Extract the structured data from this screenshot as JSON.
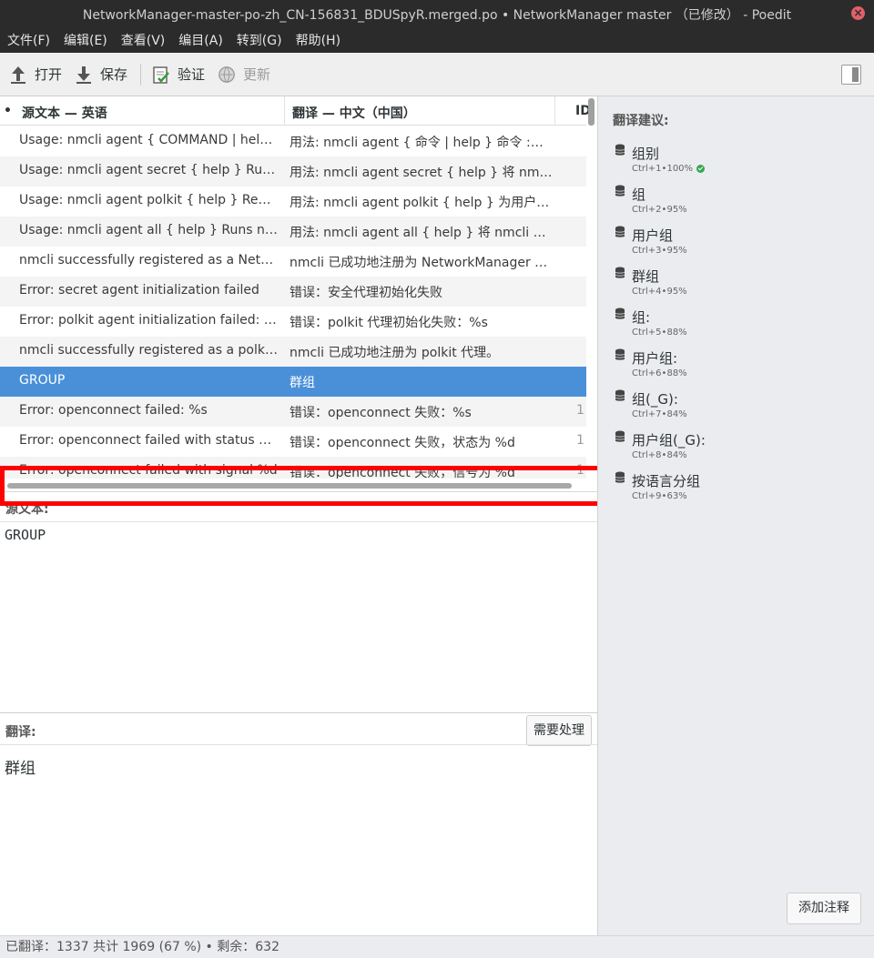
{
  "window": {
    "title": "NetworkManager-master-po-zh_CN-156831_BDUSpyR.merged.po • NetworkManager master （已修改） - Poedit",
    "close_glyph": "×"
  },
  "menu": [
    "文件(F)",
    "编辑(E)",
    "查看(V)",
    "编目(A)",
    "转到(G)",
    "帮助(H)"
  ],
  "toolbar": {
    "open_label": "打开",
    "save_label": "保存",
    "validate_label": "验证",
    "update_label": "更新"
  },
  "list": {
    "header_dot": "•",
    "col_source": "源文本 — 英语",
    "col_translation": "翻译 — 中文（中国）",
    "col_id": "ID",
    "rows": [
      {
        "src": "Usage: nmcli agent { COMMAND | help }  COMMAND := { secret | polkit | all }",
        "tr": "用法: nmcli agent { 命令 | help }  命令 := { secret | polkit | all }",
        "id": ""
      },
      {
        "src": "Usage: nmcli agent secret { help }  Runs nmcli as a NetworkManager secret agent.",
        "tr": "用法: nmcli agent secret { help }  将 nmcli 作为 NetworkManager 机密代理运行。",
        "id": ""
      },
      {
        "src": "Usage: nmcli agent polkit { help }  Registers nmcli as a polkit agent.",
        "tr": "用法: nmcli agent polkit { help }  为用户会话注册 nmcli 作为 polkit 代理。",
        "id": ""
      },
      {
        "src": "Usage: nmcli agent all { help }  Runs nmcli as both secret and polkit agent.",
        "tr": "用法: nmcli agent all { help }  将 nmcli 作为机密和 polkit 代理运行。",
        "id": ""
      },
      {
        "src": "nmcli successfully registered as a NetworkManager's secret agent.",
        "tr": "nmcli 已成功地注册为 NetworkManager 的机密代理。",
        "id": ""
      },
      {
        "src": "Error: secret agent initialization failed",
        "tr": "错误：安全代理初始化失败",
        "id": ""
      },
      {
        "src": "Error: polkit agent initialization failed: %s",
        "tr": "错误：polkit 代理初始化失败：%s",
        "id": ""
      },
      {
        "src": "nmcli successfully registered as a polkit agent.",
        "tr": "nmcli 已成功地注册为 polkit 代理。",
        "id": ""
      },
      {
        "src": "GROUP",
        "tr": "群组",
        "id": ""
      },
      {
        "src": "Error: openconnect failed: %s",
        "tr": "错误：openconnect 失败：%s",
        "id": "1"
      },
      {
        "src": "Error: openconnect failed with status %d",
        "tr": "错误：openconnect 失败，状态为 %d",
        "id": "1"
      },
      {
        "src": "Error: openconnect failed with signal %d",
        "tr": "错误：openconnect 失败，信号为 %d",
        "id": "1"
      }
    ]
  },
  "source_panel": {
    "label": "源文本:",
    "text": "GROUP"
  },
  "translation_panel": {
    "label": "翻译:",
    "fuzzy_label": "需要处理",
    "text": "群组"
  },
  "sidebar": {
    "title": "翻译建议:",
    "suggestions": [
      {
        "text": "组别",
        "shortcut": "Ctrl+1",
        "score": "100%",
        "exact": true
      },
      {
        "text": "组",
        "shortcut": "Ctrl+2",
        "score": "95%",
        "exact": false
      },
      {
        "text": "用户组",
        "shortcut": "Ctrl+3",
        "score": "95%",
        "exact": false
      },
      {
        "text": "群组",
        "shortcut": "Ctrl+4",
        "score": "95%",
        "exact": false
      },
      {
        "text": "组:",
        "shortcut": "Ctrl+5",
        "score": "88%",
        "exact": false
      },
      {
        "text": "用户组:",
        "shortcut": "Ctrl+6",
        "score": "88%",
        "exact": false
      },
      {
        "text": "组(_G):",
        "shortcut": "Ctrl+7",
        "score": "84%",
        "exact": false
      },
      {
        "text": "用户组(_G):",
        "shortcut": "Ctrl+8",
        "score": "84%",
        "exact": false
      },
      {
        "text": "按语言分组",
        "shortcut": "Ctrl+9",
        "score": "63%",
        "exact": false
      }
    ],
    "meta_separator": "•",
    "add_comment_label": "添加注释"
  },
  "status": {
    "text": "已翻译：1337 共计 1969 (67 %) • 剩余：632"
  }
}
